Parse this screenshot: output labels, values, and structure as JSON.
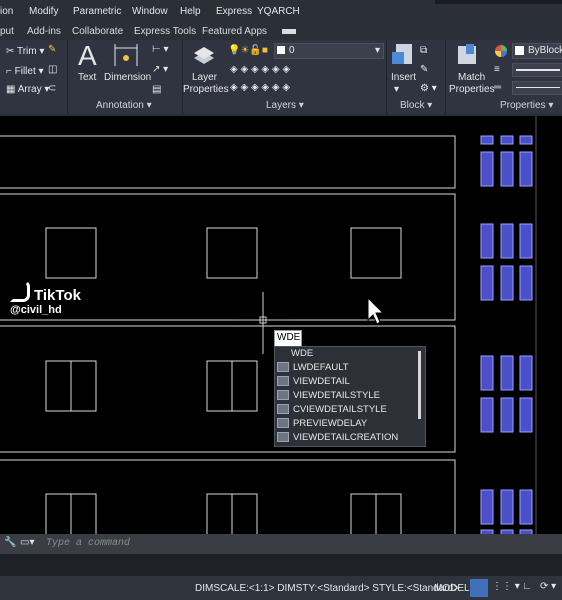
{
  "menu": [
    "ion",
    "Modify",
    "Parametric",
    "Window",
    "Help",
    "Express",
    "YQARCH"
  ],
  "tabs": [
    "put",
    "Add-ins",
    "Collaborate",
    "Express Tools",
    "Featured Apps"
  ],
  "modify": {
    "trim": "Trim",
    "fillet": "Fillet",
    "array": "Array"
  },
  "annotation": {
    "text": "Text",
    "dimension": "Dimension",
    "title": "Annotation ▾"
  },
  "layers": {
    "props": [
      "Layer",
      "Properties"
    ],
    "current": "0",
    "title": "Layers ▾"
  },
  "block": {
    "insert": "Insert",
    "title": "Block ▾"
  },
  "properties": {
    "match": [
      "Match",
      "Properties"
    ],
    "color": "ByBlock",
    "title": "Properties ▾"
  },
  "watermark": {
    "brand": "TikTok",
    "handle": "@civil_hd"
  },
  "command": {
    "typed": "WDE",
    "placeholder": "Type a command"
  },
  "autocomplete": {
    "items": [
      "WDE",
      "LWDEFAULT",
      "VIEWDETAIL",
      "VIEWDETAILSTYLE",
      "CVIEWDETAILSTYLE",
      "PREVIEWDELAY",
      "VIEWDETAILCREATION"
    ]
  },
  "status": {
    "text": "DIMSCALE:<1:1> DIMSTY:<Standard> STYLE:<Standard>",
    "model": "MODEL"
  },
  "colors": {
    "accent_blue": "#4a50c8",
    "canvas": "#000000",
    "ribbon": "#2f3440"
  }
}
